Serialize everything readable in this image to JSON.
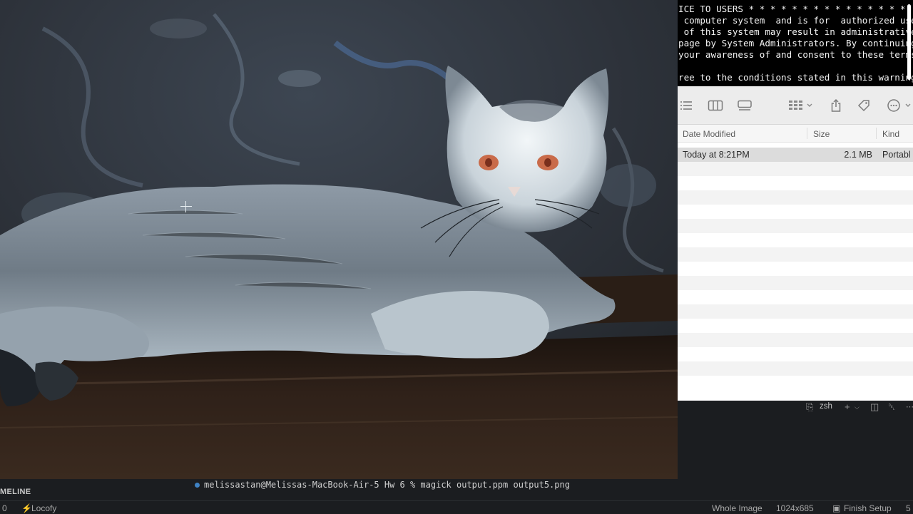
{
  "notice": {
    "lines": [
      "ICE TO USERS * * * * * * * * * * * * * * *",
      " computer system  and is for  authorized use",
      " of this system may result in administrative",
      "page by System Administrators. By continuing",
      "your awareness of and consent to these terms",
      "",
      "ree to the conditions stated in this warning"
    ]
  },
  "finder": {
    "toolbar_icons": [
      "list-view-icon",
      "column-view-icon",
      "gallery-view-icon",
      "group-icon",
      "share-icon",
      "tag-icon",
      "more-icon"
    ],
    "columns": {
      "date": "Date Modified",
      "size": "Size",
      "kind": "Kind"
    },
    "rows": [
      {
        "date": "Today at 8:21PM",
        "size": "2.1 MB",
        "kind": "Portabl"
      }
    ]
  },
  "terminal": {
    "tab_label": "zsh",
    "prompt_text": "melissastan@Melissas-MacBook-Air-5 Hw 6 % magick output.ppm output5.png"
  },
  "sidebar": {
    "section_label": "MELINE"
  },
  "statusbar": {
    "left_count": "0",
    "extension": "Locofy",
    "zoom_mode": "Whole Image",
    "dimensions": "1024x685",
    "setup": "Finish Setup",
    "cut_off": "5"
  },
  "colors": {
    "accent": "#3f82c4",
    "terminal_bg": "#000000",
    "finder_selected": "#dcdcdc"
  }
}
